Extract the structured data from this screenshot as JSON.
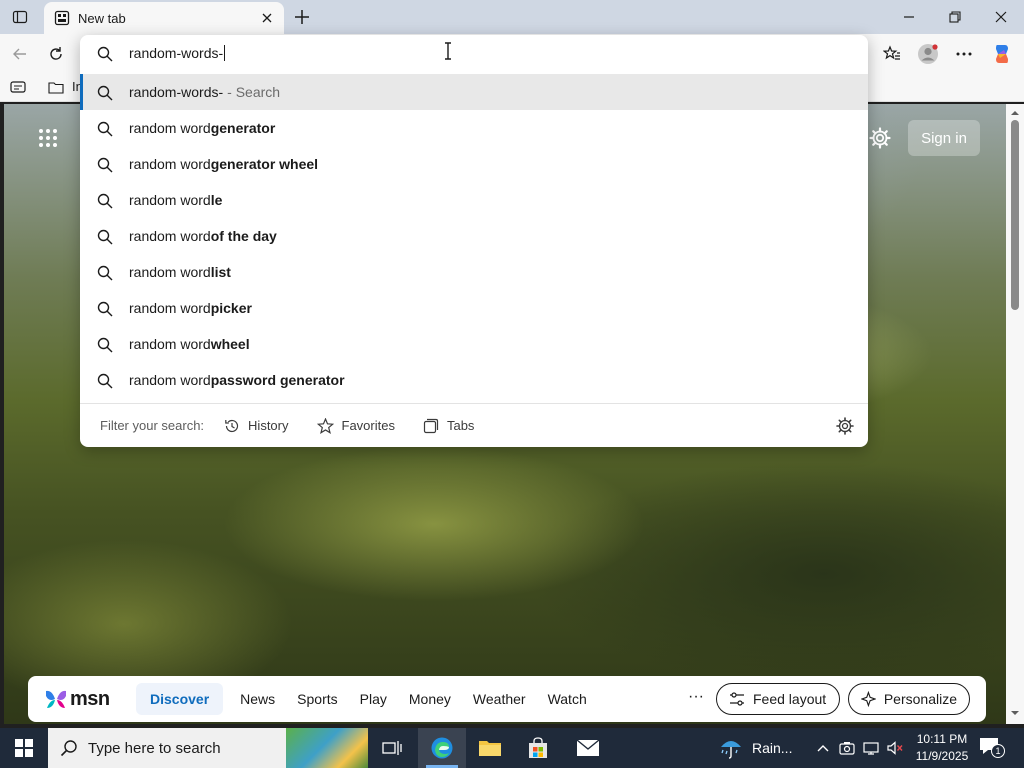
{
  "browser": {
    "tab": {
      "title": "New tab"
    }
  },
  "address_bar": {
    "value": "random-words-"
  },
  "suggestions": [
    {
      "prefix": "random-words-",
      "bold": "",
      "hint": "- Search"
    },
    {
      "prefix": "random word ",
      "bold": "generator",
      "hint": ""
    },
    {
      "prefix": "random word ",
      "bold": "generator wheel",
      "hint": ""
    },
    {
      "prefix": "random word",
      "bold": "le",
      "hint": ""
    },
    {
      "prefix": "random word ",
      "bold": "of the day",
      "hint": ""
    },
    {
      "prefix": "random word ",
      "bold": "list",
      "hint": ""
    },
    {
      "prefix": "random word ",
      "bold": "picker",
      "hint": ""
    },
    {
      "prefix": "random word ",
      "bold": "wheel",
      "hint": ""
    },
    {
      "prefix": "random word ",
      "bold": "password generator",
      "hint": ""
    }
  ],
  "filter": {
    "label": "Filter your search:",
    "history": "History",
    "favorites": "Favorites",
    "tabs": "Tabs"
  },
  "favorites_bar": {
    "first_item_partial": "In"
  },
  "ntp": {
    "sign_in": "Sign in"
  },
  "msn": {
    "logo": "msn",
    "nav": [
      "Discover",
      "News",
      "Sports",
      "Play",
      "Money",
      "Weather",
      "Watch"
    ],
    "more": "···",
    "feed_layout": "Feed layout",
    "personalize": "Personalize"
  },
  "taskbar": {
    "search_placeholder": "Type here to search",
    "weather": "Rain...",
    "time": "10:11 PM",
    "date": "11/9/2025",
    "notification_count": "1"
  },
  "colors": {
    "accent": "#0f6cbd",
    "tabbar": "#cfd7e3",
    "taskbar": "#1f2a3a"
  }
}
